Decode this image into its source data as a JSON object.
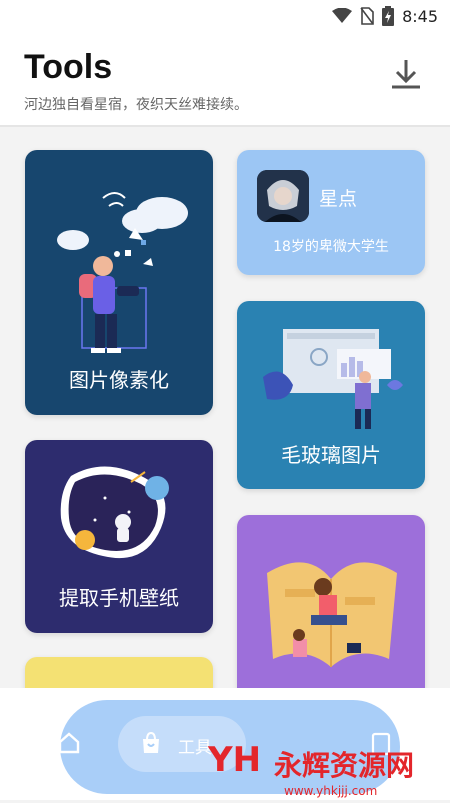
{
  "status_bar": {
    "time": "8:45",
    "icons": [
      "wifi-icon",
      "no-sim-icon",
      "battery-charging-icon"
    ]
  },
  "header": {
    "title": "Tools",
    "subtitle": "河边独自看星宿，夜织天丝难接续。",
    "action_icon": "download-icon"
  },
  "cards": {
    "pixelate": {
      "label": "图片像素化"
    },
    "profile": {
      "name": "星点",
      "description": "18岁的卑微大学生"
    },
    "frosted": {
      "label": "毛玻璃图片"
    },
    "wallpaper": {
      "label": "提取手机壁纸"
    }
  },
  "bottom_nav": {
    "items": [
      {
        "icon": "home-icon"
      },
      {
        "icon": "bag-icon",
        "label": "工具"
      },
      {
        "icon": "document-icon"
      }
    ]
  },
  "watermark": {
    "brand": "永辉资源网",
    "url": "www.yhkjjj.com"
  }
}
